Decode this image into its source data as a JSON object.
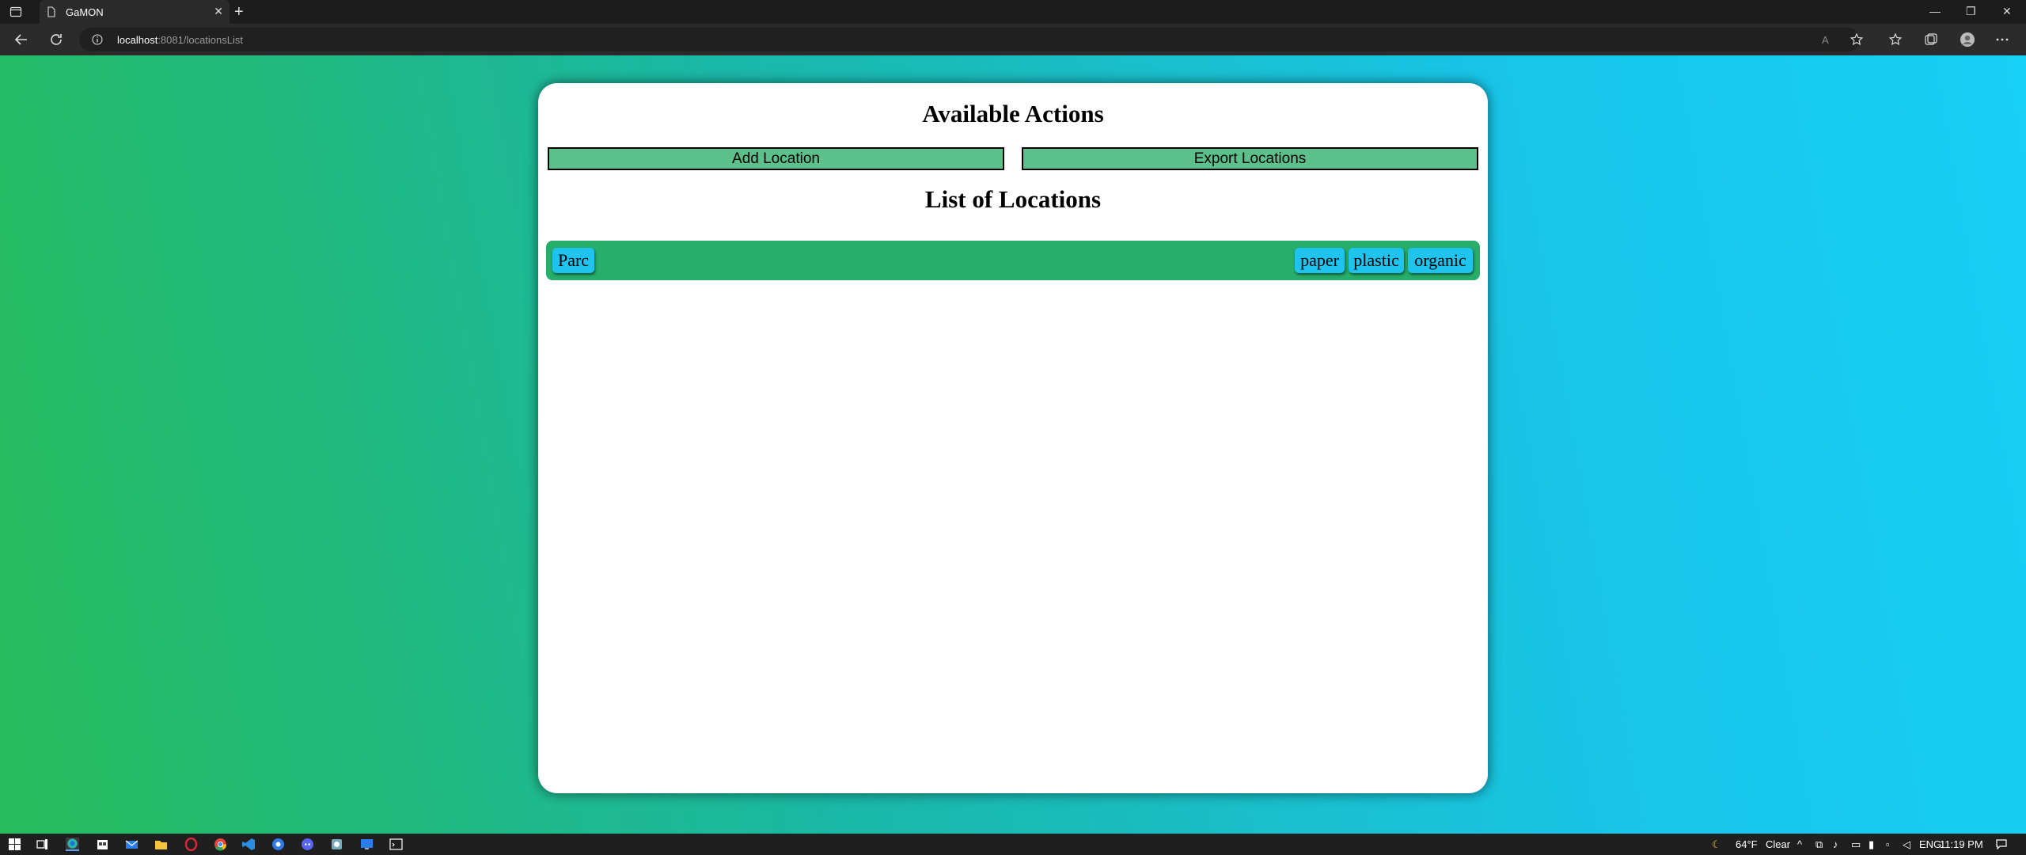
{
  "browser": {
    "tab_title": "GaMON",
    "url_host": "localhost",
    "url_path": ":8081/locationsList"
  },
  "page": {
    "actions_title": "Available Actions",
    "add_location_label": "Add Location",
    "export_locations_label": "Export Locations",
    "list_title": "List of Locations",
    "locations": [
      {
        "name": "Parc",
        "tags": [
          "paper",
          "plastic",
          "organic"
        ]
      }
    ]
  },
  "taskbar": {
    "weather_temp": "64°F",
    "weather_desc": "Clear",
    "language": "ENG",
    "time": "11:19 PM"
  },
  "colors": {
    "gradient_start": "#27bd5c",
    "gradient_end": "#18cff5",
    "action_button": "#5cc08a",
    "location_row": "#27ae6a",
    "tag_pill": "#1ec4ee"
  }
}
